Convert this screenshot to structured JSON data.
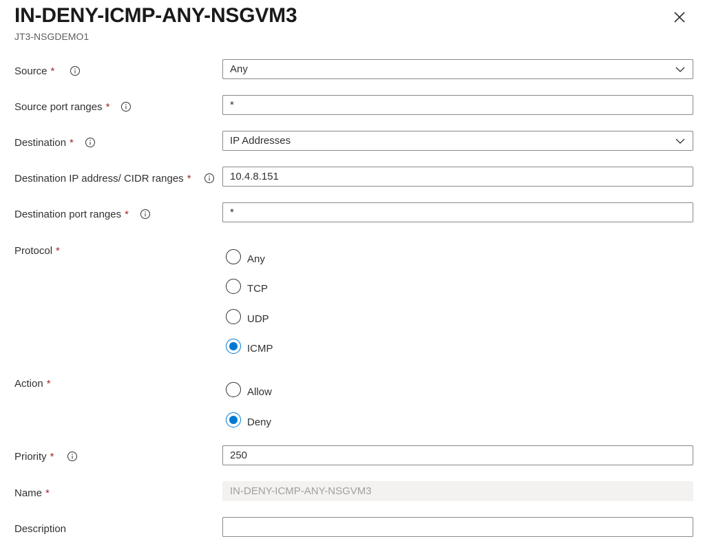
{
  "panel": {
    "title": "IN-DENY-ICMP-ANY-NSGVM3",
    "subtitle": "JT3-NSGDEMO1"
  },
  "required_marker": "*",
  "fields": {
    "source": {
      "label": "Source",
      "value": "Any"
    },
    "source_port_ranges": {
      "label": "Source port ranges",
      "value": "*"
    },
    "destination": {
      "label": "Destination",
      "value": "IP Addresses"
    },
    "destination_ip": {
      "label": "Destination IP address/ CIDR ranges",
      "value": "10.4.8.151"
    },
    "destination_port_ranges": {
      "label": "Destination port ranges",
      "value": "*"
    },
    "priority": {
      "label": "Priority",
      "value": "250"
    },
    "name": {
      "label": "Name",
      "value": "IN-DENY-ICMP-ANY-NSGVM3"
    },
    "description": {
      "label": "Description",
      "value": ""
    }
  },
  "protocol": {
    "label": "Protocol",
    "options": [
      "Any",
      "TCP",
      "UDP",
      "ICMP"
    ],
    "selected": "ICMP"
  },
  "action": {
    "label": "Action",
    "options": [
      "Allow",
      "Deny"
    ],
    "selected": "Deny"
  },
  "colors": {
    "accent": "#0078d4",
    "required": "#a4262c",
    "border": "#8a8886",
    "disabled_bg": "#f3f2f1"
  },
  "icons": {
    "close": "close-icon",
    "info": "info-icon",
    "dropdown": "chevron-down-icon"
  }
}
